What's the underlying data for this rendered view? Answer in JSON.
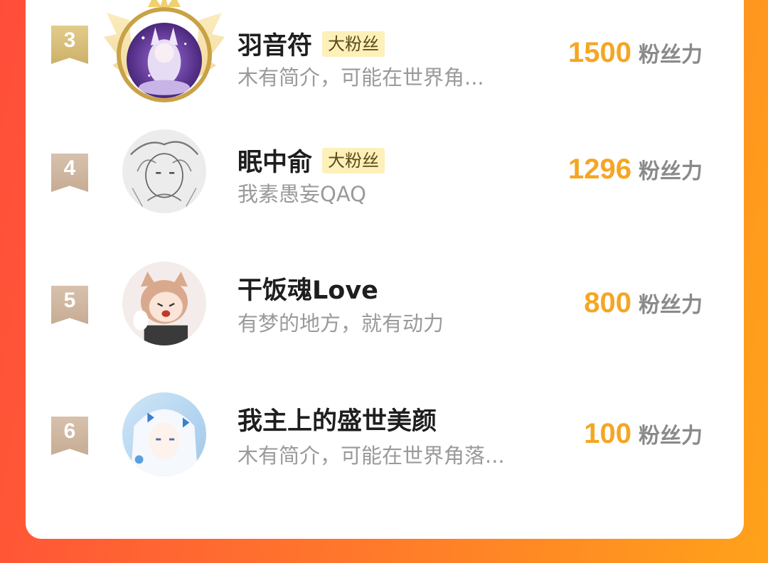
{
  "colors": {
    "score": "#f5a623",
    "badge_bg": "#fdf0b8",
    "bg_left": "#ff4d3a",
    "bg_right": "#ffa21a"
  },
  "ranking": [
    {
      "rank": "3",
      "rank_style": "gold",
      "avatar_icon": "anime-avatar-purple-crowned",
      "name": "羽音符",
      "badge": "大粉丝",
      "bio": "木有简介，可能在世界角...",
      "score": "1500",
      "unit": "粉丝力"
    },
    {
      "rank": "4",
      "rank_style": "beige",
      "avatar_icon": "anime-avatar-sketch",
      "name": "眠中俞",
      "badge": "大粉丝",
      "bio": "我素愚妄QAQ",
      "score": "1296",
      "unit": "粉丝力"
    },
    {
      "rank": "5",
      "rank_style": "beige",
      "avatar_icon": "anime-avatar-catgirl",
      "name": "干饭魂Love",
      "badge": "",
      "bio": "有梦的地方，就有动力",
      "score": "800",
      "unit": "粉丝力"
    },
    {
      "rank": "6",
      "rank_style": "beige",
      "avatar_icon": "anime-avatar-white-hair",
      "name": "我主上的盛世美颜",
      "badge": "",
      "bio": "木有简介，可能在世界角落...",
      "score": "100",
      "unit": "粉丝力"
    }
  ]
}
